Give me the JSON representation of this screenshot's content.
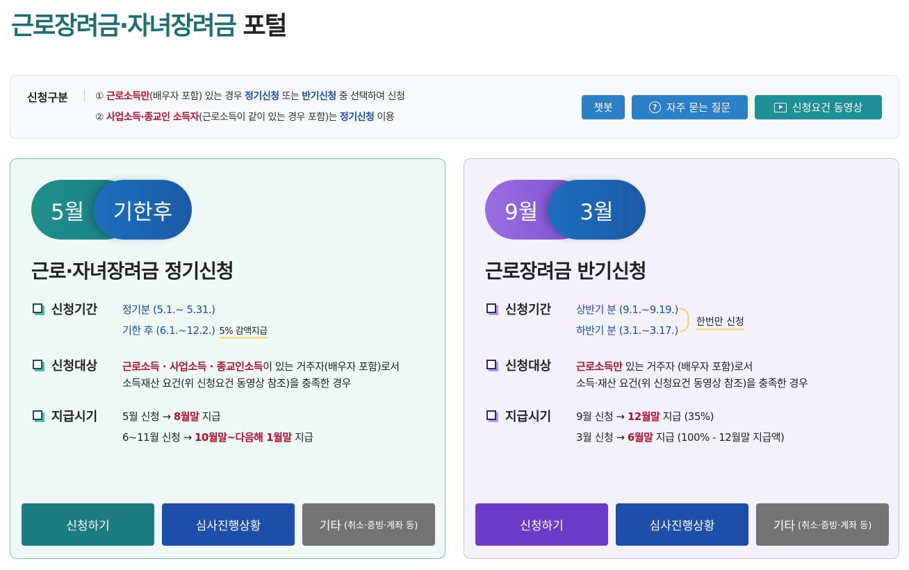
{
  "header": {
    "title_highlight": "근로장려금·자녀장려금",
    "title_rest": "포털"
  },
  "info": {
    "label": "신청구분",
    "line1": {
      "num": "①",
      "red": "근로소득만",
      "t1": "(배우자 포함) 있는 경우 ",
      "blue1": "정기신청",
      "t2": " 또는 ",
      "blue2": "반기신청",
      "t3": " 중 선택하여 신청"
    },
    "line2": {
      "num": "②",
      "red": "사업소득·종교인 소득자",
      "t1": "(근로소득이 같이 있는 경우 포함)는 ",
      "blue1": "정기신청",
      "t2": " 이용"
    },
    "buttons": {
      "chatbot": "챗봇",
      "faq": "자주 묻는 질문",
      "video": "신청요건 동영상"
    }
  },
  "left_card": {
    "pill_a": "5월",
    "pill_b": "기한후",
    "title": "근로·자녀장려금 정기신청",
    "period": {
      "label": "신청기간",
      "row1": "정기분 (5.1.~ 5.31.)",
      "row2": "기한 후 (6.1.~12.2.)",
      "note": "5% 감액지급"
    },
    "target": {
      "label": "신청대상",
      "red": "근로소득 · 사업소득 · 종교인소득",
      "t1": "이 있는 거주자(배우자 포함)로서",
      "t2": "소득재산 요건(위 신청요건 동영상 참조)을 충족한 경우"
    },
    "pay": {
      "label": "지급시기",
      "r1a": "5월 신청 → ",
      "r1b": "8월말",
      "r1c": " 지급",
      "r2a": "6~11월 신청 → ",
      "r2b": "10월말~다음해 1월말",
      "r2c": " 지급"
    },
    "buttons": {
      "apply": "신청하기",
      "status": "심사진행상황",
      "etc": "기타",
      "etc_small": "(취소·증빙·계좌 등)"
    }
  },
  "right_card": {
    "pill_a": "9월",
    "pill_b": "3월",
    "title": "근로장려금 반기신청",
    "period": {
      "label": "신청기간",
      "row1": "상반기 분 (9.1.~9.19.)",
      "row2": "하반기 분 (3.1.~3.17.)",
      "note": "한번만 신청"
    },
    "target": {
      "label": "신청대상",
      "red": "근로소득만",
      "t1": " 있는 거주자 (배우자 포함)로서",
      "t2": "소득·재산 요건(위 신청요건 동영상 참조)을 충족한 경우"
    },
    "pay": {
      "label": "지급시기",
      "r1a": "9월 신청 → ",
      "r1b": "12월말",
      "r1c": " 지급 (35%)",
      "r2a": "3월 신청 → ",
      "r2b": "6월말",
      "r2c": " 지급 (100% - 12월말 지급액)"
    },
    "buttons": {
      "apply": "신청하기",
      "status": "심사진행상황",
      "etc": "기타",
      "etc_small": "(취소·증빙·계좌 등)"
    }
  }
}
